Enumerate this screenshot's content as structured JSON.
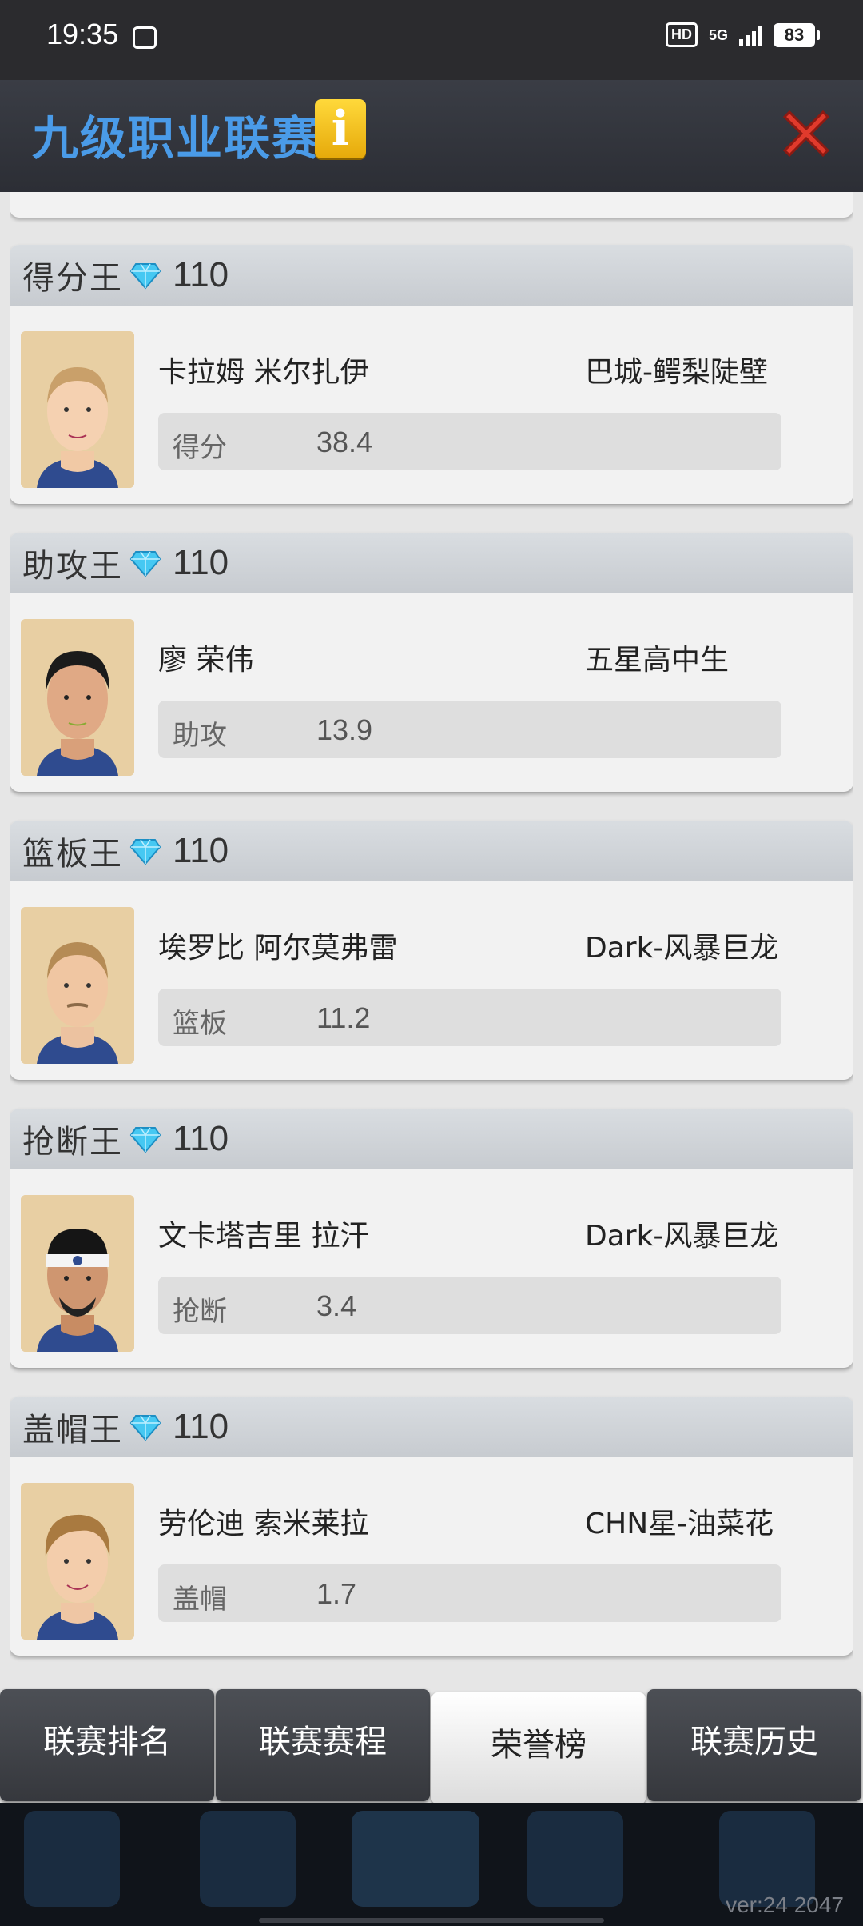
{
  "status_bar": {
    "time": "19:35",
    "hd": "HD",
    "network": "5G",
    "battery": "83"
  },
  "header": {
    "title": "九级职业联赛",
    "info_icon": "i",
    "close_icon": "close-icon"
  },
  "awards": [
    {
      "title": "得分王",
      "reward": "110",
      "player": "卡拉姆 米尔扎伊",
      "team": "巴城-鳄梨陡壁",
      "stat_label": "得分",
      "stat_value": "38.4"
    },
    {
      "title": "助攻王",
      "reward": "110",
      "player": "廖 荣伟",
      "team": "五星高中生",
      "stat_label": "助攻",
      "stat_value": "13.9"
    },
    {
      "title": "篮板王",
      "reward": "110",
      "player": "埃罗比 阿尔莫弗雷",
      "team": "Dark-风暴巨龙",
      "stat_label": "篮板",
      "stat_value": "11.2"
    },
    {
      "title": "抢断王",
      "reward": "110",
      "player": "文卡塔吉里 拉汗",
      "team": "Dark-风暴巨龙",
      "stat_label": "抢断",
      "stat_value": "3.4"
    },
    {
      "title": "盖帽王",
      "reward": "110",
      "player": "劳伦迪 索米莱拉",
      "team": "CHN星-油菜花",
      "stat_label": "盖帽",
      "stat_value": "1.7"
    }
  ],
  "tabs": [
    "联赛排名",
    "联赛赛程",
    "荣誉榜",
    "联赛历史"
  ],
  "active_tab": "荣誉榜",
  "version": "ver:24  2047",
  "colors": {
    "title_blue": "#4a9be8",
    "header_bg": "#2c2e35",
    "card_head": "#c7cbd0",
    "accent_gold": "#ffd93b"
  }
}
